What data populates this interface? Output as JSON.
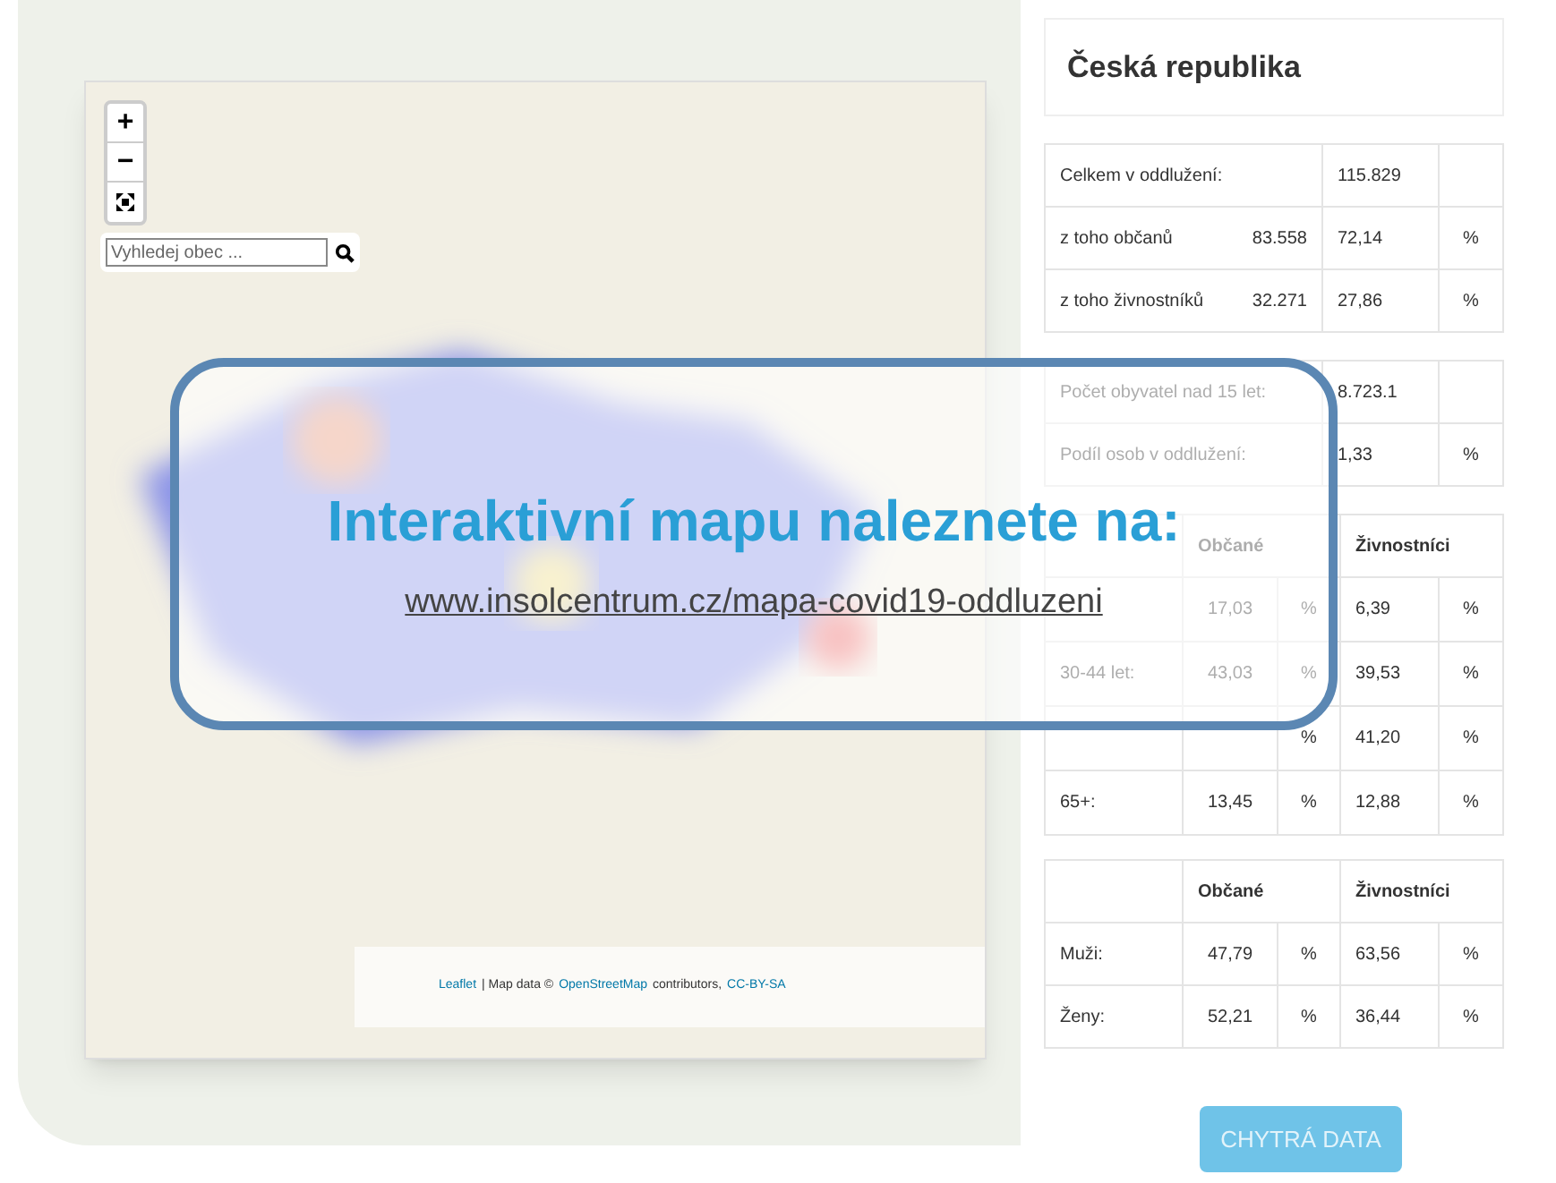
{
  "map": {
    "zoom_in": "+",
    "zoom_out": "−",
    "search": {
      "placeholder": "Vyhledej obec ..."
    },
    "attribution": [
      {
        "kind": "link",
        "text": "Leaflet"
      },
      {
        "kind": "text",
        "text": "| Map data ©"
      },
      {
        "kind": "link",
        "text": "OpenStreetMap"
      },
      {
        "kind": "text",
        "text": "contributors,"
      },
      {
        "kind": "link",
        "text": "CC-BY-SA"
      }
    ]
  },
  "panel": {
    "title": "Česká republika",
    "totals": [
      {
        "label": "Celkem v oddlužení:",
        "value": "115.829"
      },
      {
        "label": "z toho občanů",
        "count": "83.558",
        "value": "72,14",
        "unit": "%"
      },
      {
        "label": "z toho živnostníků",
        "count": "32.271",
        "value": "27,86",
        "unit": "%"
      }
    ],
    "population": [
      {
        "label": "Počet obyvatel nad 15 let:",
        "value": "8.723.1"
      },
      {
        "label": "Podíl osob v oddlužení:",
        "value": "1,33",
        "unit": "%"
      }
    ],
    "age_table": {
      "columns": [
        "Občané",
        "Živnostníci"
      ],
      "rows": [
        {
          "obcane": "17,03",
          "obcane_unit": "%",
          "zivnostnici": "6,39",
          "zivnostnici_unit": "%"
        },
        {
          "label": "30-44 let:",
          "obcane": "43,03",
          "obcane_unit": "%",
          "zivnostnici": "39,53",
          "zivnostnici_unit": "%"
        },
        {
          "obcane_unit": "%",
          "zivnostnici": "41,20",
          "zivnostnici_unit": "%"
        },
        {
          "label": "65+:",
          "obcane": "13,45",
          "obcane_unit": "%",
          "zivnostnici": "12,88",
          "zivnostnici_unit": "%"
        }
      ]
    },
    "gender_table": {
      "columns": [
        "Občané",
        "Živnostníci"
      ],
      "rows": [
        {
          "label": "Muži:",
          "obcane": "47,79",
          "obcane_unit": "%",
          "zivnostnici": "63,56",
          "zivnostnici_unit": "%"
        },
        {
          "label": "Ženy:",
          "obcane": "52,21",
          "obcane_unit": "%",
          "zivnostnici": "36,44",
          "zivnostnici_unit": "%"
        }
      ]
    },
    "button": "CHYTRÁ DATA"
  },
  "overlay": {
    "title": "Interaktivní mapu naleznete na:",
    "link": "www.insolcentrum.cz/mapa-covid19-oddluzeni"
  }
}
